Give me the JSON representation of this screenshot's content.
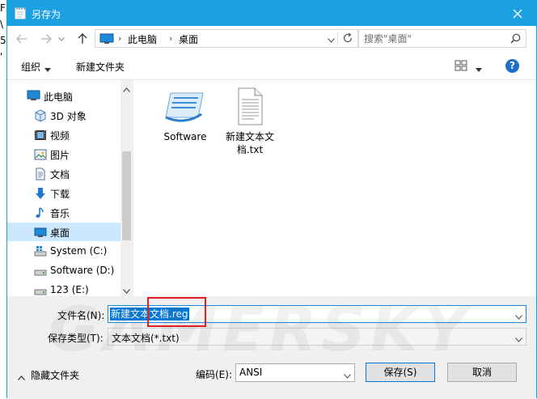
{
  "background_glyphs": [
    "F",
    "\\",
    "5",
    "'"
  ],
  "titlebar": {
    "title": "另存为",
    "color": "#1ba1e2"
  },
  "address": {
    "crumbs": [
      "此电脑",
      "桌面"
    ]
  },
  "search": {
    "placeholder": "搜索\"桌面\""
  },
  "toolbar": {
    "organize": "组织",
    "new_folder": "新建文件夹"
  },
  "sidebar": {
    "items": [
      {
        "label": "此电脑",
        "icon": "pc-icon"
      },
      {
        "label": "3D 对象",
        "icon": "3d-objects-icon"
      },
      {
        "label": "视频",
        "icon": "video-icon"
      },
      {
        "label": "图片",
        "icon": "pictures-icon"
      },
      {
        "label": "文档",
        "icon": "documents-icon"
      },
      {
        "label": "下载",
        "icon": "download-icon"
      },
      {
        "label": "音乐",
        "icon": "music-icon"
      },
      {
        "label": "桌面",
        "icon": "desktop-icon",
        "selected": true
      },
      {
        "label": "System (C:)",
        "icon": "drive-icon"
      },
      {
        "label": "Software (D:)",
        "icon": "drive-icon"
      },
      {
        "label": "123 (E:)",
        "icon": "drive-icon"
      }
    ]
  },
  "files": [
    {
      "name": "Software",
      "icon": "shortcut-icon"
    },
    {
      "name_line1": "新建文本文",
      "name_line2": "档.txt",
      "icon": "text-file-icon"
    }
  ],
  "form": {
    "filename_label": "文件名(N):",
    "filename_value": "新建文本文档.reg",
    "filetype_label": "保存类型(T):",
    "filetype_value": "文本文档(*.txt)"
  },
  "footer": {
    "hide_folders": "隐藏文件夹",
    "encoding_label": "编码(E):",
    "encoding_value": "ANSI",
    "save": "保存(S)",
    "cancel": "取消"
  },
  "watermark": "GAMERSKY"
}
